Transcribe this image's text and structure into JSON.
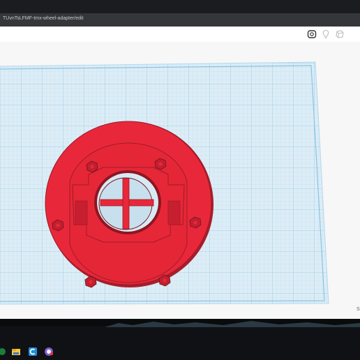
{
  "browser": {
    "url": "TUvnTsLFMF-tmx-wheel-adapter/edit"
  },
  "toolbar": {
    "icons": [
      "view-cube-icon",
      "bulb-icon",
      "cube-icon"
    ]
  },
  "workplane": {
    "corner_text": "S"
  },
  "colors": {
    "part_fill": "#e8283a",
    "part_edge": "#9a1a26",
    "grid_bg": "#dfeef7",
    "grid_line": "#a9d3ea"
  },
  "taskbar": {
    "icons": [
      "windows-start-icon",
      "file-explorer-icon",
      "app-c-icon",
      "chat-app-icon"
    ]
  }
}
